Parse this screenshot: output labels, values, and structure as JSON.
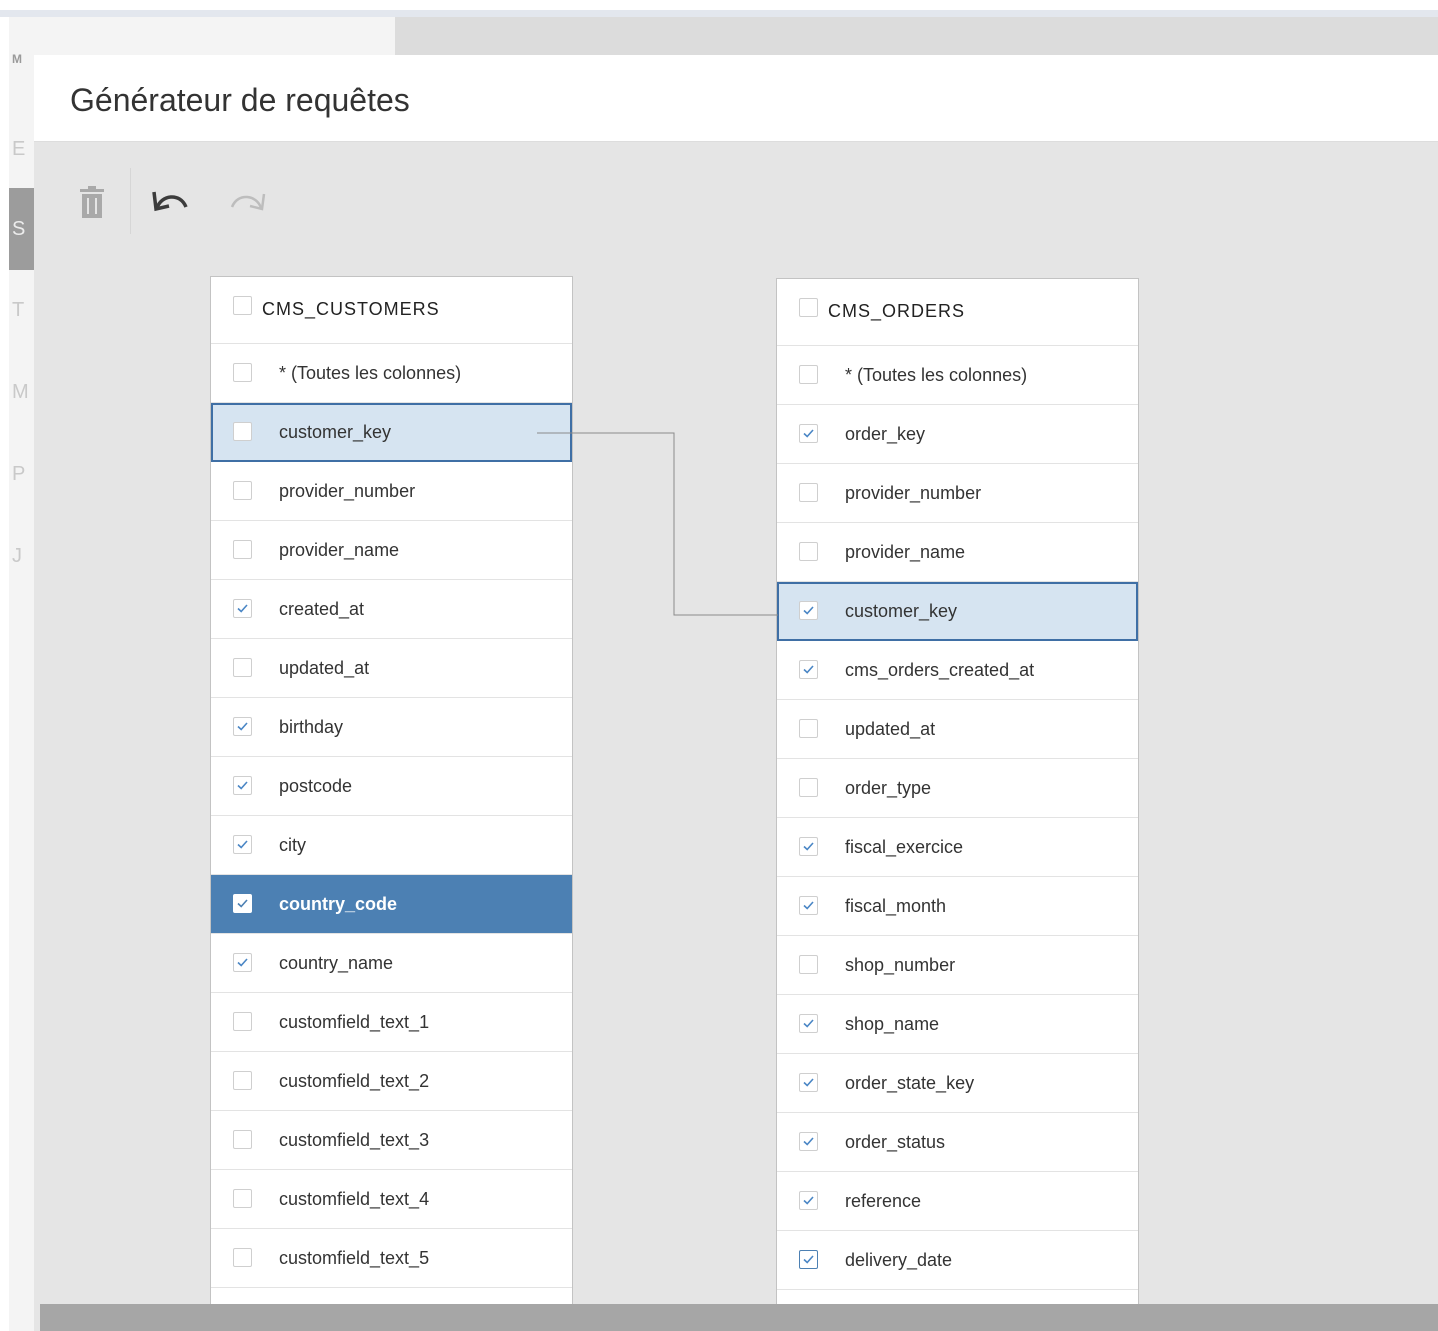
{
  "background": {
    "side_letters": [
      "M",
      "E",
      "S",
      "T",
      "M",
      "P",
      "J"
    ]
  },
  "modal": {
    "title": "Générateur de requêtes"
  },
  "toolbar": {
    "icons": [
      "trash-icon",
      "undo-icon",
      "redo-icon"
    ]
  },
  "tables": {
    "customers": {
      "name": "CMS_CUSTOMERS",
      "rows": [
        {
          "label": "* (Toutes les colonnes)",
          "checked": false
        },
        {
          "label": "customer_key",
          "checked": false,
          "join_key": true
        },
        {
          "label": "provider_number",
          "checked": false
        },
        {
          "label": "provider_name",
          "checked": false
        },
        {
          "label": "created_at",
          "checked": true
        },
        {
          "label": "updated_at",
          "checked": false
        },
        {
          "label": "birthday",
          "checked": true
        },
        {
          "label": "postcode",
          "checked": true
        },
        {
          "label": "city",
          "checked": true
        },
        {
          "label": "country_code",
          "checked": true,
          "active": true
        },
        {
          "label": "country_name",
          "checked": true
        },
        {
          "label": "customfield_text_1",
          "checked": false
        },
        {
          "label": "customfield_text_2",
          "checked": false
        },
        {
          "label": "customfield_text_3",
          "checked": false
        },
        {
          "label": "customfield_text_4",
          "checked": false
        },
        {
          "label": "customfield_text_5",
          "checked": false
        }
      ]
    },
    "orders": {
      "name": "CMS_ORDERS",
      "rows": [
        {
          "label": "* (Toutes les colonnes)",
          "checked": false
        },
        {
          "label": "order_key",
          "checked": true
        },
        {
          "label": "provider_number",
          "checked": false
        },
        {
          "label": "provider_name",
          "checked": false
        },
        {
          "label": "customer_key",
          "checked": true,
          "join_key": true
        },
        {
          "label": "cms_orders_created_at",
          "checked": true
        },
        {
          "label": "updated_at",
          "checked": false
        },
        {
          "label": "order_type",
          "checked": false
        },
        {
          "label": "fiscal_exercice",
          "checked": true
        },
        {
          "label": "fiscal_month",
          "checked": true
        },
        {
          "label": "shop_number",
          "checked": false
        },
        {
          "label": "shop_name",
          "checked": true
        },
        {
          "label": "order_state_key",
          "checked": true
        },
        {
          "label": "order_status",
          "checked": true
        },
        {
          "label": "reference",
          "checked": true
        },
        {
          "label": "delivery_date",
          "checked": true,
          "strong": true
        }
      ]
    }
  },
  "colors": {
    "accent": "#4c80b3",
    "join_highlight": "#d6e4f1",
    "join_border": "#3f6fa5",
    "check_mark": "#4a86c5",
    "join_line": "#8a8a8a"
  }
}
